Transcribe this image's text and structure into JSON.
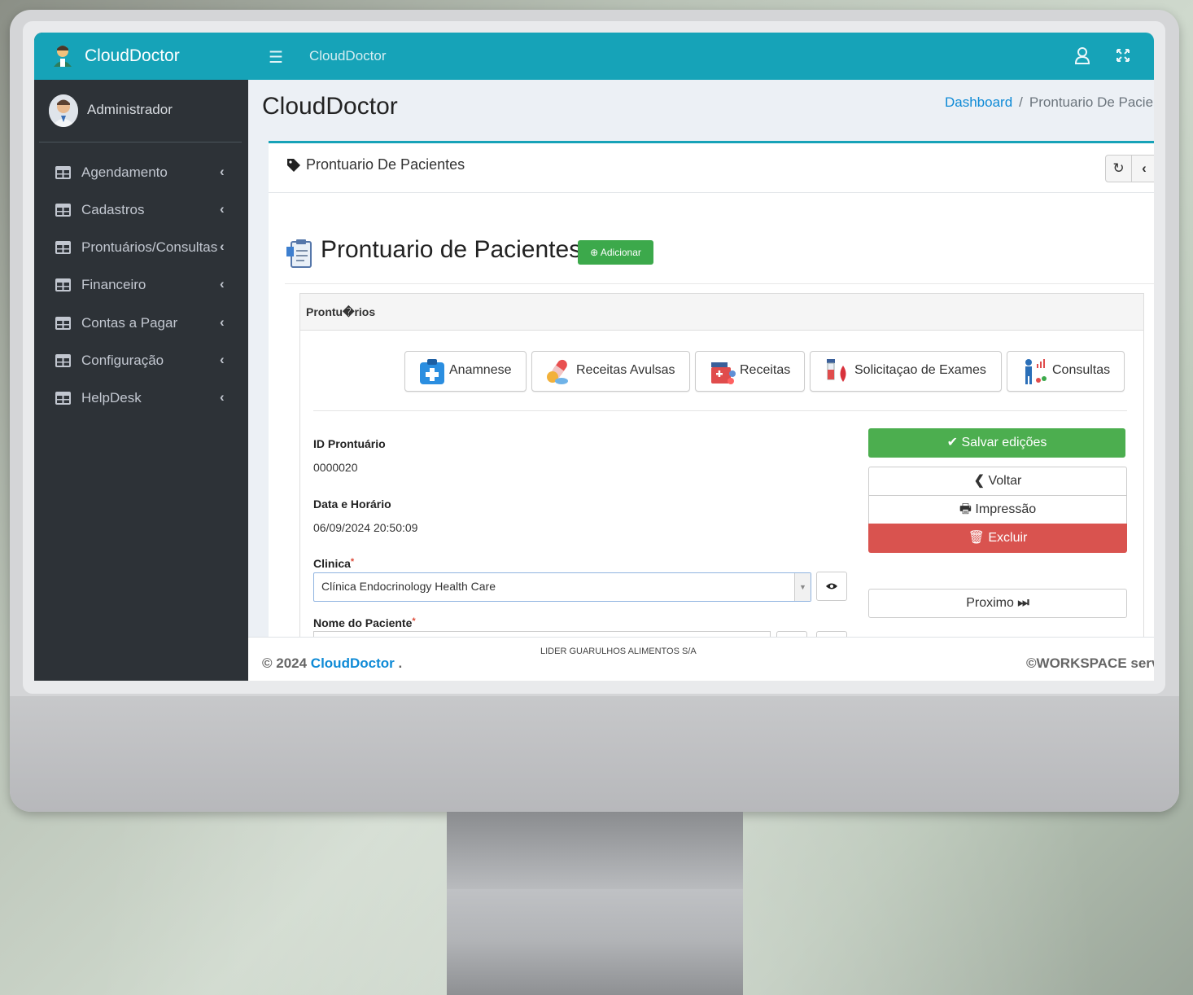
{
  "app": {
    "logo_text": "CloudDoctor",
    "topbar_title": "CloudDoctor"
  },
  "sidebar": {
    "user_name": "Administrador",
    "items": [
      {
        "label": "Agendamento"
      },
      {
        "label": "Cadastros"
      },
      {
        "label": "Prontuários/Consultas"
      },
      {
        "label": "Financeiro"
      },
      {
        "label": "Contas a Pagar"
      },
      {
        "label": "Configuração"
      },
      {
        "label": "HelpDesk"
      }
    ],
    "chevron": "‹"
  },
  "header": {
    "page_title": "CloudDoctor",
    "breadcrumb_home": "Dashboard",
    "breadcrumb_sep": "/",
    "breadcrumb_current": "Prontuario De Pacie"
  },
  "card": {
    "title": "Prontuario De Pacientes",
    "section_title": "Prontuario de Pacientes",
    "add_label": "Adicionar"
  },
  "panel": {
    "title": "Prontu�rios",
    "tabs": [
      {
        "label": "Anamnese",
        "icon": "clipboard-medical-icon"
      },
      {
        "label": "Receitas Avulsas",
        "icon": "pills-icon"
      },
      {
        "label": "Receitas",
        "icon": "medicine-kit-icon"
      },
      {
        "label": "Solicitaçao de Exames",
        "icon": "blood-test-icon"
      },
      {
        "label": "Consultas",
        "icon": "patient-chart-icon"
      }
    ]
  },
  "form": {
    "id_label": "ID Prontuário",
    "id_value": "0000020",
    "date_label": "Data e Horário",
    "date_value": "06/09/2024 20:50:09",
    "clinic_label": "Clinica",
    "clinic_value": "Clínica Endocrinology Health Care",
    "patient_label": "Nome do Paciente",
    "required_mark": "*"
  },
  "actions": {
    "save": "Salvar edições",
    "back": "Voltar",
    "print": "Impressão",
    "delete": "Excluir",
    "next": "Proximo"
  },
  "footer": {
    "copyright": "© 2024 ",
    "brand": "CloudDoctor",
    "dot": " .",
    "company": "LIDER GUARULHOS ALIMENTOS S/A",
    "right": "©WORKSPACE serv"
  },
  "colors": {
    "topbar": "#16a3b8",
    "sidebar": "#2d3237",
    "success": "#4cae4f",
    "danger": "#d9534f",
    "link": "#0e8ad6"
  }
}
